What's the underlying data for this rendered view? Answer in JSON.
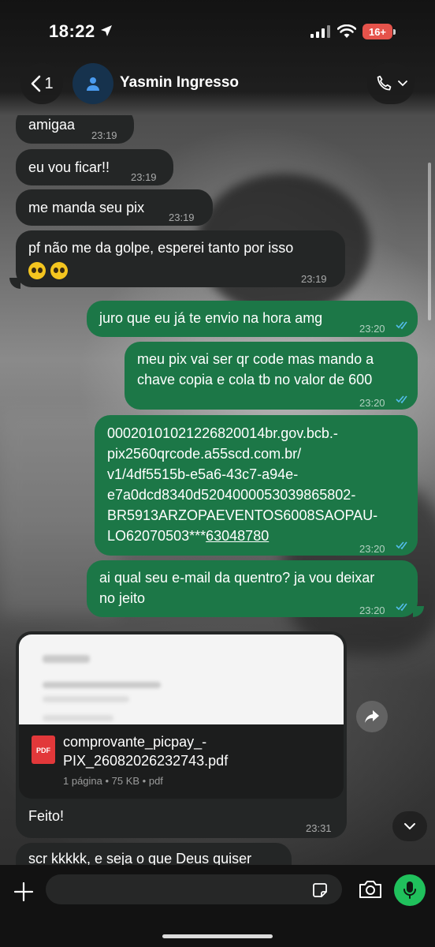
{
  "status_bar": {
    "time": "18:22",
    "battery": "16+",
    "battery_color": "#e5534b"
  },
  "header": {
    "back_count": "1",
    "contact_name": "Yasmin Ingresso",
    "avatar_icon": "person-icon",
    "call_icon": "phone-icon"
  },
  "messages": [
    {
      "dir": "in",
      "text": "amigaa",
      "time": "23:19"
    },
    {
      "dir": "in",
      "text": "eu vou ficar!!",
      "time": "23:19"
    },
    {
      "dir": "in",
      "text": "me manda seu pix",
      "time": "23:19"
    },
    {
      "dir": "in",
      "text": "pf não me da golpe, esperei tanto por isso",
      "time": "23:19",
      "emojis": "pleading-face pleading-face"
    },
    {
      "dir": "out",
      "text": "juro que eu já te envio na hora amg",
      "time": "23:20"
    },
    {
      "dir": "out",
      "line1": "meu pix vai ser qr code mas mando a",
      "line2": "chave copia e cola tb no valor de 600",
      "time": "23:20"
    },
    {
      "dir": "out",
      "lines": [
        "00020101021226820014br.gov.bcb.-",
        "pix2560qrcode.a55scd.com.br/",
        "v1/4df5515b-e5a6-43c7-a94e-",
        "e7a0dcd8340d5204000053039865802-",
        "BR5913ARZOPAEVENTOS6008SAOPAU-",
        "LO62070503***"
      ],
      "link": "63048780",
      "time": "23:20"
    },
    {
      "dir": "out",
      "line1": "ai qual seu e-mail da quentro? ja vou deixar",
      "line2": "no jeito",
      "time": "23:20"
    },
    {
      "dir": "in",
      "document": {
        "name_line1": "comprovante_picpay_-",
        "name_line2": "PIX_26082026232743.pdf",
        "meta": "1 página • 75 KB • pdf",
        "icon_label": "PDF"
      },
      "text": "Feito!",
      "time": "23:31"
    },
    {
      "dir": "in",
      "text": "scr kkkkk, e seja o que Deus quiser"
    }
  ],
  "input": {
    "placeholder": ""
  },
  "colors": {
    "incoming_bubble": "#242626",
    "outgoing_bubble": "#1c7747",
    "read_ticks": "#53bdeb",
    "mic_button": "#20c15c"
  }
}
